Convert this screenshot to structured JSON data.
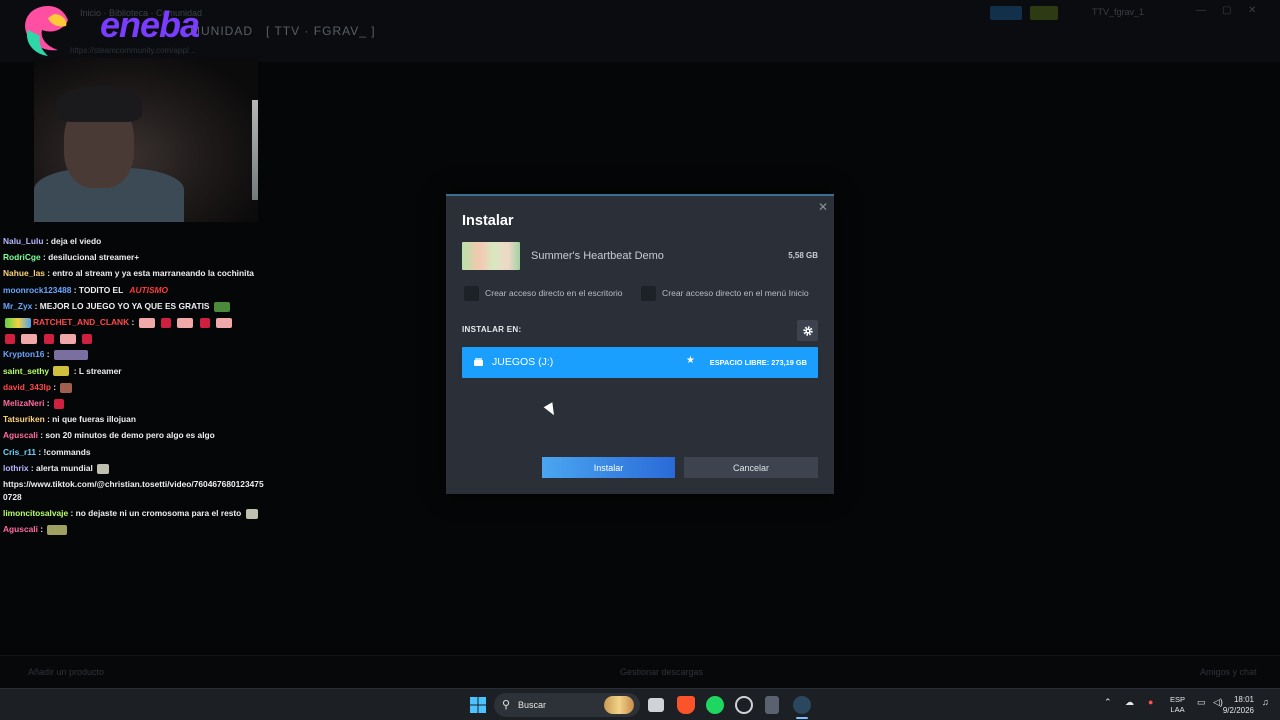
{
  "background_app": {
    "stream_title": "[ TTV · FGRAV_ ]",
    "stream_title_prefix": "MUNIDAD",
    "breadcrumb": "Inicio · Biblioteca · Comunidad",
    "url": "https://steamcommunity.com/app/...",
    "user_label": "TTV_fgrav_1",
    "bottom_left": "Añadir un producto",
    "bottom_center": "Gestionar descargas",
    "bottom_right": "Amigos y chat"
  },
  "overlay": {
    "logo_text": "eneba"
  },
  "chat": [
    {
      "user": "Nalu_Lulu",
      "user_color": "#b7b7ff",
      "text": ": deja el viedo"
    },
    {
      "user": "RodriCge",
      "user_color": "#7dff9a",
      "text": ": desilucional streamer+"
    },
    {
      "user": "Nahue_las",
      "user_color": "#ffd37a",
      "text": ": entro al stream y ya esta marraneando la cochinita"
    },
    {
      "user": "moonrock123488",
      "user_color": "#6aa6ff",
      "text": ": TODITO EL",
      "extra": "AUTISMO",
      "extra_color": "#ff3b3b"
    },
    {
      "user": "Mr_Zyx",
      "user_color": "#6aa6ff",
      "text": ": MEJOR LO JUEGO YO YA QUE ES GRATIS"
    },
    {
      "user": "RATCHET_AND_CLANK",
      "user_color": "#ff4a4a",
      "text": ":"
    },
    {
      "user": "",
      "user_color": "#ffffff",
      "text": ""
    },
    {
      "user": "Krypton16",
      "user_color": "#6aa6ff",
      "text": ":"
    },
    {
      "user": "saint_sethy",
      "user_color": "#b8ff6a",
      "text": ": L streamer"
    },
    {
      "user": "david_343lp",
      "user_color": "#ff4a4a",
      "text": ":"
    },
    {
      "user": "MelizaNeri",
      "user_color": "#ff6aa0",
      "text": ":"
    },
    {
      "user": "Tatsuriken",
      "user_color": "#ffd37a",
      "text": ": ni que fueras illojuan"
    },
    {
      "user": "Aguscali",
      "user_color": "#ff6aa0",
      "text": ": son 20 minutos de demo pero algo es algo"
    },
    {
      "user": "Cris_r11",
      "user_color": "#6ad6ff",
      "text": ": !commands"
    },
    {
      "user": "lothrix",
      "user_color": "#b7b7ff",
      "text": ": alerta mundial"
    },
    {
      "user": "",
      "user_color": "#ffffff",
      "text": "https://www.tiktok.com/@christian.tosetti/video/7604676801234750728"
    },
    {
      "user": "limoncitosalvaje",
      "user_color": "#b8ff6a",
      "text": ": no dejaste ni un cromosoma para el resto"
    },
    {
      "user": "Aguscali",
      "user_color": "#ff6aa0",
      "text": ":"
    }
  ],
  "dialog": {
    "title": "Instalar",
    "game_name": "Summer's Heartbeat Demo",
    "game_size": "5,58 GB",
    "checkbox_desktop": "Crear acceso directo en el escritorio",
    "checkbox_start": "Crear acceso directo en el menú Inicio",
    "install_in_label": "INSTALAR EN:",
    "drive_label": "JUEGOS (J:)",
    "free_space": "ESPACIO LIBRE: 273,19 GB",
    "install_button": "Instalar",
    "cancel_button": "Cancelar"
  },
  "taskbar": {
    "search_label": "Buscar",
    "lang_top": "ESP",
    "lang_bottom": "LAA",
    "time": "18:01",
    "date": "9/2/2026"
  }
}
